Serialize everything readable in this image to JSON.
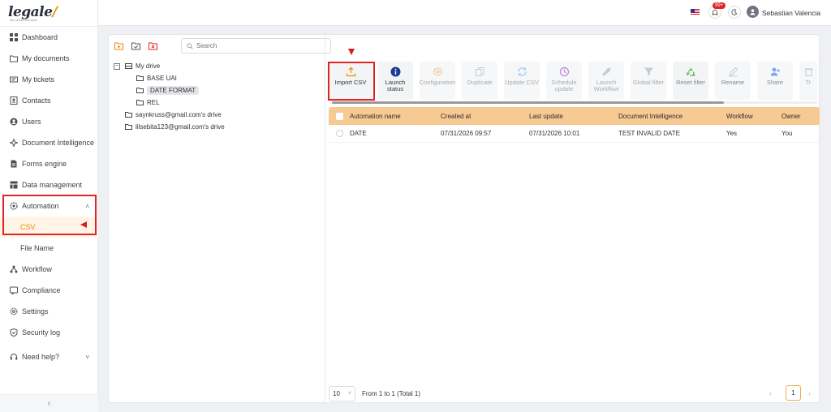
{
  "brand": {
    "name": "legale",
    "tagline": "law, secure and value",
    "accent": "#f08a00"
  },
  "sidebar": {
    "items": [
      {
        "label": "Dashboard",
        "icon": "grid-icon"
      },
      {
        "label": "My documents",
        "icon": "folder-icon"
      },
      {
        "label": "My tickets",
        "icon": "ticket-icon"
      },
      {
        "label": "Contacts",
        "icon": "contacts-icon"
      },
      {
        "label": "Users",
        "icon": "user-icon"
      },
      {
        "label": "Document Intelligence",
        "icon": "sparkle-icon"
      },
      {
        "label": "Forms engine",
        "icon": "form-icon"
      },
      {
        "label": "Data management",
        "icon": "data-icon"
      },
      {
        "label": "Automation",
        "icon": "gear-icon"
      },
      {
        "label": "Workflow",
        "icon": "workflow-icon"
      },
      {
        "label": "Compliance",
        "icon": "compliance-icon"
      },
      {
        "label": "Settings",
        "icon": "settings-icon"
      },
      {
        "label": "Security log",
        "icon": "shield-icon"
      },
      {
        "label": "Need help?",
        "icon": "headset-icon"
      }
    ],
    "automation_sub": [
      {
        "label": "CSV"
      },
      {
        "label": "File Name"
      }
    ],
    "collapse_label": "‹"
  },
  "topbar": {
    "notification_count": "99+",
    "user_name": "Sebastian Valencia"
  },
  "tree": {
    "search_placeholder": "Search",
    "nodes": [
      {
        "label": "My drive",
        "level": 0
      },
      {
        "label": "BASE UAI",
        "level": 1
      },
      {
        "label": "DATE FORMAT",
        "level": 1
      },
      {
        "label": "REL",
        "level": 1
      },
      {
        "label": "saynkruss@gmail.com's drive",
        "level": 0
      },
      {
        "label": "lilsebita123@gmail.com's drive",
        "level": 0
      }
    ]
  },
  "toolbar": {
    "buttons": [
      {
        "label": "Import CSV",
        "icon": "upload-icon"
      },
      {
        "label": "Launch status",
        "icon": "info-icon"
      },
      {
        "label": "Configuration",
        "icon": "cog-icon"
      },
      {
        "label": "Duplicate",
        "icon": "duplicate-icon"
      },
      {
        "label": "Update CSV",
        "icon": "refresh-icon"
      },
      {
        "label": "Schedule update",
        "icon": "schedule-icon"
      },
      {
        "label": "Launch Workflow",
        "icon": "rocket-icon"
      },
      {
        "label": "Global filter",
        "icon": "filter-icon"
      },
      {
        "label": "Reset filter",
        "icon": "recycle-icon"
      },
      {
        "label": "Rename",
        "icon": "pencil-icon"
      },
      {
        "label": "Share",
        "icon": "share-user-icon"
      },
      {
        "label": "Tr",
        "icon": "trash-icon"
      }
    ]
  },
  "table": {
    "headers": [
      "Automation name",
      "Created at",
      "Last update",
      "Document Intelligence",
      "Workflow",
      "Owner"
    ],
    "rows": [
      [
        "DATE",
        "07/31/2026 09:57",
        "07/31/2026 10:01",
        "TEST INVALID DATE",
        "Yes",
        "You"
      ]
    ]
  },
  "pagination": {
    "page_size": "10",
    "info": "From 1 to 1 (Total 1)",
    "current_page": "1"
  }
}
